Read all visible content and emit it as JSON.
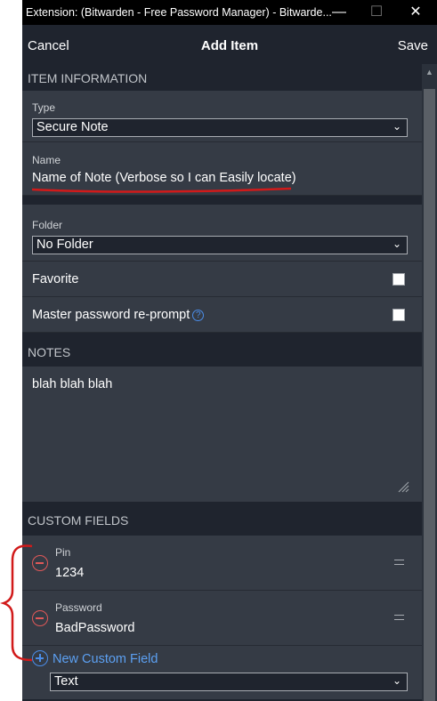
{
  "titlebar": {
    "title": "Extension: (Bitwarden - Free Password Manager) - Bitwarde...",
    "minimize_glyph": "—",
    "maximize_glyph": "☐",
    "close_glyph": "✕"
  },
  "navbar": {
    "cancel_label": "Cancel",
    "title": "Add Item",
    "save_label": "Save"
  },
  "item_information": {
    "header": "ITEM INFORMATION",
    "type_label": "Type",
    "type_value": "Secure Note",
    "name_label": "Name",
    "name_value": "Name of Note (Verbose so I can Easily locate)",
    "folder_label": "Folder",
    "folder_value": "No Folder",
    "favorite_label": "Favorite",
    "reprompt_label": "Master password re-prompt",
    "reprompt_help_glyph": "?"
  },
  "notes": {
    "header": "NOTES",
    "value": "blah blah blah"
  },
  "custom_fields": {
    "header": "CUSTOM FIELDS",
    "fields": [
      {
        "label": "Pin",
        "value": "1234"
      },
      {
        "label": "Password",
        "value": "BadPassword"
      }
    ],
    "new_field_label": "New Custom Field",
    "new_field_type": "Text"
  },
  "icons": {
    "select_chevron": "chevron-down-icon",
    "remove": "minus-circle-icon",
    "add": "plus-circle-icon",
    "drag": "drag-handle-icon",
    "help": "question-circle-icon"
  },
  "colors": {
    "background": "#1f242e",
    "box": "#353b45",
    "accent": "#4b8de8",
    "danger": "#e05858",
    "annotation": "#d11a1a"
  }
}
